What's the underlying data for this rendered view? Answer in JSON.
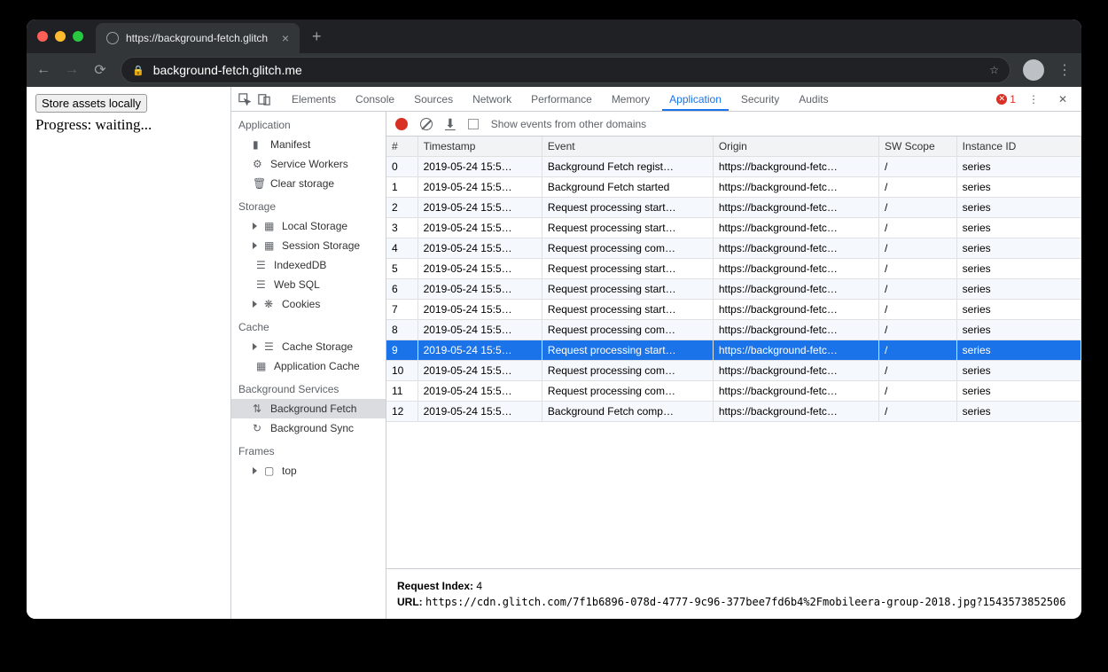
{
  "browser": {
    "tab_title": "https://background-fetch.glitch",
    "url": "background-fetch.glitch.me",
    "new_tab": "+",
    "close_tab": "×"
  },
  "page": {
    "button_label": "Store assets locally",
    "progress": "Progress: waiting..."
  },
  "devtools": {
    "tabs": [
      "Elements",
      "Console",
      "Sources",
      "Network",
      "Performance",
      "Memory",
      "Application",
      "Security",
      "Audits"
    ],
    "active_tab": "Application",
    "warning_count": "1",
    "kebab": "⋮",
    "close": "✕"
  },
  "sidebar": {
    "section_app": "Application",
    "items_app": [
      "Manifest",
      "Service Workers",
      "Clear storage"
    ],
    "section_storage": "Storage",
    "items_storage": [
      "Local Storage",
      "Session Storage",
      "IndexedDB",
      "Web SQL",
      "Cookies"
    ],
    "section_cache": "Cache",
    "items_cache": [
      "Cache Storage",
      "Application Cache"
    ],
    "section_bg": "Background Services",
    "items_bg": [
      "Background Fetch",
      "Background Sync"
    ],
    "selected_bg": "Background Fetch",
    "section_frames": "Frames",
    "items_frames": [
      "top"
    ]
  },
  "table": {
    "show_other_label": "Show events from other domains",
    "columns": [
      "#",
      "Timestamp",
      "Event",
      "Origin",
      "SW Scope",
      "Instance ID"
    ],
    "selected_row": 9,
    "rows": [
      {
        "n": "0",
        "ts": "2019-05-24 15:5…",
        "ev": "Background Fetch regist…",
        "or": "https://background-fetc…",
        "sw": "/",
        "id": "series"
      },
      {
        "n": "1",
        "ts": "2019-05-24 15:5…",
        "ev": "Background Fetch started",
        "or": "https://background-fetc…",
        "sw": "/",
        "id": "series"
      },
      {
        "n": "2",
        "ts": "2019-05-24 15:5…",
        "ev": "Request processing start…",
        "or": "https://background-fetc…",
        "sw": "/",
        "id": "series"
      },
      {
        "n": "3",
        "ts": "2019-05-24 15:5…",
        "ev": "Request processing start…",
        "or": "https://background-fetc…",
        "sw": "/",
        "id": "series"
      },
      {
        "n": "4",
        "ts": "2019-05-24 15:5…",
        "ev": "Request processing com…",
        "or": "https://background-fetc…",
        "sw": "/",
        "id": "series"
      },
      {
        "n": "5",
        "ts": "2019-05-24 15:5…",
        "ev": "Request processing start…",
        "or": "https://background-fetc…",
        "sw": "/",
        "id": "series"
      },
      {
        "n": "6",
        "ts": "2019-05-24 15:5…",
        "ev": "Request processing start…",
        "or": "https://background-fetc…",
        "sw": "/",
        "id": "series"
      },
      {
        "n": "7",
        "ts": "2019-05-24 15:5…",
        "ev": "Request processing start…",
        "or": "https://background-fetc…",
        "sw": "/",
        "id": "series"
      },
      {
        "n": "8",
        "ts": "2019-05-24 15:5…",
        "ev": "Request processing com…",
        "or": "https://background-fetc…",
        "sw": "/",
        "id": "series"
      },
      {
        "n": "9",
        "ts": "2019-05-24 15:5…",
        "ev": "Request processing start…",
        "or": "https://background-fetc…",
        "sw": "/",
        "id": "series"
      },
      {
        "n": "10",
        "ts": "2019-05-24 15:5…",
        "ev": "Request processing com…",
        "or": "https://background-fetc…",
        "sw": "/",
        "id": "series"
      },
      {
        "n": "11",
        "ts": "2019-05-24 15:5…",
        "ev": "Request processing com…",
        "or": "https://background-fetc…",
        "sw": "/",
        "id": "series"
      },
      {
        "n": "12",
        "ts": "2019-05-24 15:5…",
        "ev": "Background Fetch comp…",
        "or": "https://background-fetc…",
        "sw": "/",
        "id": "series"
      }
    ]
  },
  "details": {
    "request_index_label": "Request Index:",
    "request_index_value": "4",
    "url_label": "URL:",
    "url_value": "https://cdn.glitch.com/7f1b6896-078d-4777-9c96-377bee7fd6b4%2Fmobileera-group-2018.jpg?1543573852506"
  }
}
